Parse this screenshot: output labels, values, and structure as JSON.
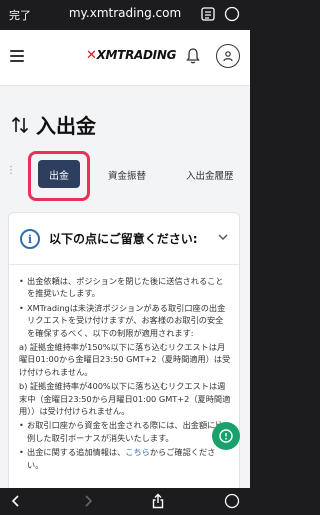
{
  "browser": {
    "done_label": "完了",
    "url": "my.xmtrading.com"
  },
  "site": {
    "logo_prefix": "✕",
    "logo_text": "XMTRADING"
  },
  "page": {
    "title": "入出金",
    "title_icon": "swap-arrows-icon"
  },
  "tabs": [
    {
      "label": "出金",
      "active": true
    },
    {
      "label": "資金振替",
      "active": false
    },
    {
      "label": "入出金履歴",
      "active": false
    }
  ],
  "notice": {
    "title": "以下の点にご留意ください:",
    "items": [
      {
        "text": "出金依頼は、ポジションを閉じた後に送信されることを推奨いたします。"
      },
      {
        "text": "XMTradingは未決済ポジションがある取引口座の出金リクエストを受け付けますが、お客様のお取引の安全を確保するべく、以下の制限が適用されます:"
      },
      {
        "text": "a) 証拠金維持率が150%以下に落ち込むリクエストは月曜日01:00から金曜日23:50 GMT+2（夏時間適用）は受け付けられません。",
        "plain": true
      },
      {
        "text": "b) 証拠金維持率が400%以下に落ち込むリクエストは週末中（金曜日23:50から月曜日01:00 GMT+2（夏時間適用））は受け付けられません。",
        "plain": true
      },
      {
        "text": "お取引口座から資金を出金される際には、出金額に比例した取引ボーナスが消失いたします。"
      },
      {
        "text_before": "出金に関する追加情報は、",
        "link": "こちら",
        "text_after": "からご確認ください。"
      }
    ]
  },
  "colors": {
    "accent_navy": "#2d3e5e",
    "highlight_pink": "#e8305a",
    "info_blue": "#2f6fb0",
    "fab_green": "#1aa06a",
    "logo_red": "#d71920"
  }
}
